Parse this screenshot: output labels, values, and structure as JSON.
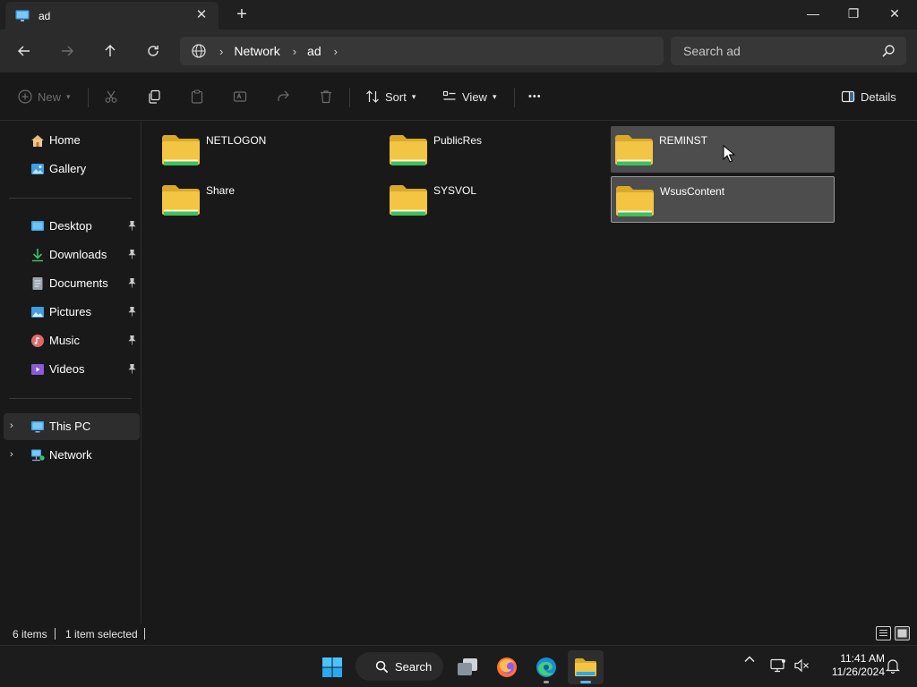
{
  "window": {
    "tab_title": "ad",
    "tab_close": "✕",
    "new_tab": "+",
    "minimize": "—",
    "restore": "❐",
    "close": "✕"
  },
  "address": {
    "icon": "globe-icon",
    "crumbs": [
      "Network",
      "ad"
    ],
    "separator": "›"
  },
  "search": {
    "placeholder": "Search ad"
  },
  "toolbar": {
    "new_label": "New",
    "sort_label": "Sort",
    "view_label": "View",
    "more_label": "•••",
    "details_label": "Details"
  },
  "sidebar": {
    "items": [
      {
        "label": "Home",
        "icon": "home-icon"
      },
      {
        "label": "Gallery",
        "icon": "gallery-icon"
      },
      {
        "label": "Desktop",
        "icon": "desktop-icon",
        "pinned": true
      },
      {
        "label": "Downloads",
        "icon": "downloads-icon",
        "pinned": true
      },
      {
        "label": "Documents",
        "icon": "documents-icon",
        "pinned": true
      },
      {
        "label": "Pictures",
        "icon": "pictures-icon",
        "pinned": true
      },
      {
        "label": "Music",
        "icon": "music-icon",
        "pinned": true
      },
      {
        "label": "Videos",
        "icon": "videos-icon",
        "pinned": true
      },
      {
        "label": "This PC",
        "icon": "this-pc-icon",
        "selected": true
      },
      {
        "label": "Network",
        "icon": "network-icon"
      }
    ],
    "pin_glyph": "📌",
    "expand_glyph": "›"
  },
  "folders": [
    {
      "name": "NETLOGON",
      "state": "normal"
    },
    {
      "name": "PublicRes",
      "state": "normal"
    },
    {
      "name": "REMINST",
      "state": "hover"
    },
    {
      "name": "Share",
      "state": "normal"
    },
    {
      "name": "SYSVOL",
      "state": "normal"
    },
    {
      "name": "WsusContent",
      "state": "selected"
    }
  ],
  "status": {
    "item_count": "6 items",
    "selection": "1 item selected"
  },
  "taskbar": {
    "search_label": "Search",
    "apps": [
      "start-icon",
      "task-view-icon",
      "firefox-icon",
      "edge-icon",
      "file-explorer-icon"
    ],
    "time": "11:41 AM",
    "date": "11/26/2024"
  },
  "colors": {
    "folder_yellow": "#f4c542",
    "folder_green": "#3fbf5f",
    "accent_blue": "#5fb2f2"
  }
}
